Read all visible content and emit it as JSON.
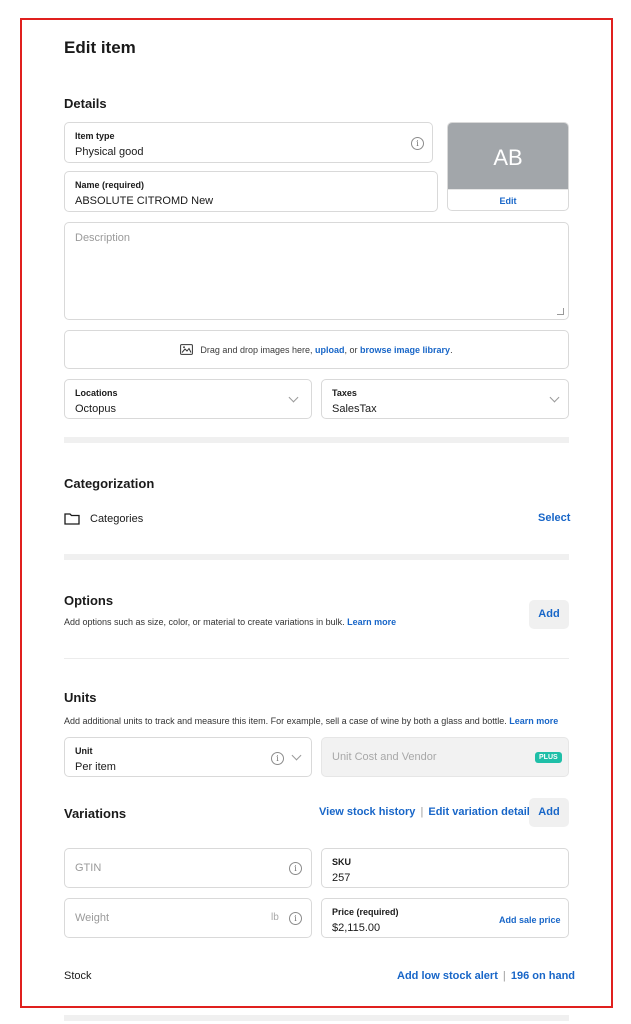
{
  "page": {
    "title": "Edit item"
  },
  "details": {
    "heading": "Details",
    "item_type": {
      "label": "Item type",
      "value": "Physical good"
    },
    "name": {
      "label": "Name (required)",
      "value": "ABSOLUTE CITROMD New"
    },
    "thumbnail": {
      "initials": "AB",
      "edit_label": "Edit"
    },
    "description": {
      "placeholder": "Description"
    },
    "dropzone": {
      "text_before": "Drag and drop images here, ",
      "upload": "upload",
      "text_mid": ", or ",
      "browse": "browse image library",
      "text_after": "."
    },
    "locations": {
      "label": "Locations",
      "value": "Octopus"
    },
    "taxes": {
      "label": "Taxes",
      "value": "SalesTax"
    }
  },
  "categorization": {
    "heading": "Categorization",
    "categories_label": "Categories",
    "select_label": "Select"
  },
  "options": {
    "heading": "Options",
    "description": "Add options such as size, color, or material to create variations in bulk. ",
    "learn_more": "Learn more",
    "add_label": "Add"
  },
  "units": {
    "heading": "Units",
    "description": "Add additional units to track and measure this item. For example, sell a case of wine by both a glass and bottle. ",
    "learn_more": "Learn more",
    "unit": {
      "label": "Unit",
      "value": "Per item"
    },
    "unit_cost": {
      "placeholder": "Unit Cost and Vendor",
      "badge": "PLUS"
    }
  },
  "variations": {
    "heading": "Variations",
    "view_stock_history": "View stock history",
    "separator": "|",
    "edit_variation_details": "Edit variation details",
    "add_label": "Add",
    "gtin": {
      "placeholder": "GTIN"
    },
    "sku": {
      "label": "SKU",
      "value": "257"
    },
    "weight": {
      "placeholder": "Weight",
      "unit": "lb"
    },
    "price": {
      "label": "Price (required)",
      "value": "$2,115.00",
      "add_sale_price": "Add sale price"
    }
  },
  "stock": {
    "label": "Stock",
    "add_low_stock_alert": "Add low stock alert",
    "separator": "|",
    "on_hand": "196 on hand"
  }
}
